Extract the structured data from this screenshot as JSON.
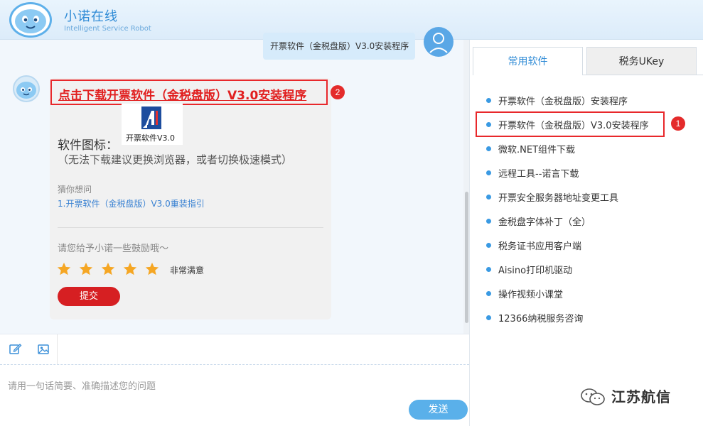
{
  "header": {
    "title": "小诺在线",
    "subtitle": "Intelligent Service Robot"
  },
  "chat": {
    "user_message": "开票软件（金税盘版）V3.0安装程序",
    "bot": {
      "download_link": "点击下载开票软件（金税盘版）V3.0安装程序",
      "download_badge": "2",
      "app_icon_label": "开票软件V3.0",
      "software_icon_label": "软件图标：",
      "hint": "（无法下载建议更换浏览器，或者切换极速模式）",
      "guess_title": "猜你想问",
      "guess_links": [
        "1.开票软件（金税盘版）V3.0重装指引"
      ],
      "feedback_prompt": "请您给予小诺一些鼓励哦～",
      "rating": 5,
      "rating_max": 5,
      "rating_text": "非常满意",
      "submit_label": "提交"
    }
  },
  "input": {
    "placeholder": "请用一句话简要、准确描述您的问题",
    "send_label": "发送"
  },
  "right_panel": {
    "tabs": [
      {
        "label": "常用软件",
        "active": true
      },
      {
        "label": "税务UKey",
        "active": false
      }
    ],
    "items": [
      "开票软件（金税盘版）安装程序",
      "开票软件（金税盘版）V3.0安装程序",
      "微软.NET组件下载",
      "远程工具--诺言下载",
      "开票安全服务器地址变更工具",
      "金税盘字体补丁（全）",
      "税务证书应用客户端",
      "Aisino打印机驱动",
      "操作视频小课堂",
      "12366纳税服务咨询"
    ],
    "highlight_badge": "1"
  },
  "watermark": {
    "text": "江苏航信"
  },
  "colors": {
    "brand_blue": "#2f8bd6",
    "link_blue": "#3a82d2",
    "bullet_blue": "#3a9ae3",
    "annotation_red": "#e8282b",
    "star_orange": "#f5a623",
    "submit_red": "#d61f22",
    "send_blue": "#5ab0ea"
  },
  "icons": [
    "robot-logo-icon",
    "user-avatar-icon",
    "bot-avatar-icon",
    "edit-icon",
    "image-icon",
    "star-icon",
    "wechat-icon"
  ]
}
